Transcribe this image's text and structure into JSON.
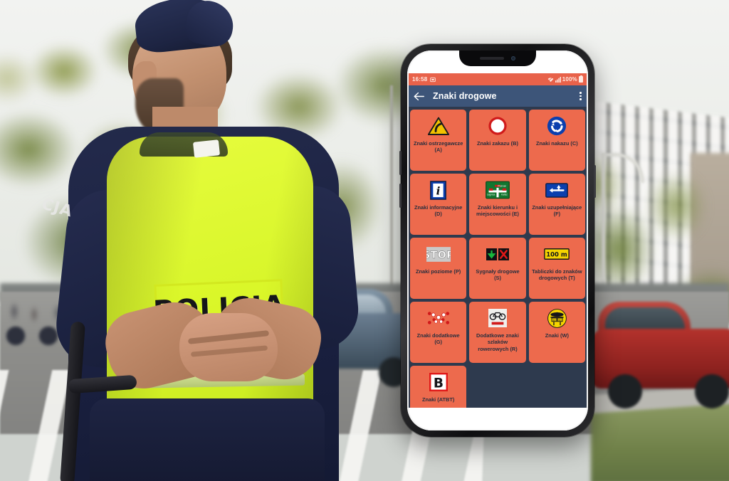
{
  "background": {
    "description": "Blurred street photo: police officer in high-visibility vest facing away, pedestrian crossing, cars and buildings",
    "vest_text": "POLICJA",
    "sleeve_text": "CJA"
  },
  "phone": {
    "status_bar": {
      "time": "16:58",
      "left_icon": "screenshot-icon",
      "wifi_icon": "wifi-icon",
      "signal_icon": "signal-bars-icon",
      "battery_percent": "100%",
      "battery_icon": "battery-full-icon",
      "background_color": "#e8624a",
      "text_color": "#ffe9e2"
    },
    "app_bar": {
      "back_icon": "back-arrow-icon",
      "title": "Znaki drogowe",
      "overflow_icon": "overflow-menu-icon",
      "background_color": "#3d5579"
    },
    "grid": {
      "background_color": "#2e3a4e",
      "tile_color": "#ed6a4d",
      "tile_text_color": "#2a2f3e",
      "tiles": [
        {
          "id": "A",
          "icon": "warning-triangle-curve-sign",
          "label": "Znaki ostrzegawcze (A)"
        },
        {
          "id": "B",
          "icon": "prohibition-circle-sign",
          "label": "Znaki zakazu (B)"
        },
        {
          "id": "C",
          "icon": "roundabout-mandatory-sign",
          "label": "Znaki nakazu (C)"
        },
        {
          "id": "D",
          "icon": "information-i-sign",
          "label": "Znaki informacyjne (D)"
        },
        {
          "id": "E",
          "icon": "green-direction-sign",
          "label": "Znaki kierunku i miejscowości (E)"
        },
        {
          "id": "F",
          "icon": "blue-supplementary-arrow-sign",
          "label": "Znaki uzupełniające (F)"
        },
        {
          "id": "P",
          "icon": "stop-road-marking",
          "label": "Znaki poziome (P)"
        },
        {
          "id": "S",
          "icon": "lane-signal-sign",
          "label": "Sygnały drogowe (S)"
        },
        {
          "id": "T",
          "icon": "yellow-distance-plate",
          "label": "Tabliczki do znaków drogowych (T)"
        },
        {
          "id": "G",
          "icon": "red-white-marker-sign",
          "label": "Znaki dodatkowe (G)"
        },
        {
          "id": "R",
          "icon": "bicycle-route-plate",
          "label": "Dodatkowe znaki szlaków rowerowych (R)"
        },
        {
          "id": "W",
          "icon": "yellow-waterway-sign",
          "label": "Znaki (W)"
        },
        {
          "id": "ATBT",
          "icon": "letter-b-red-border-sign",
          "label": "Znaki (ATBT)"
        }
      ]
    }
  }
}
